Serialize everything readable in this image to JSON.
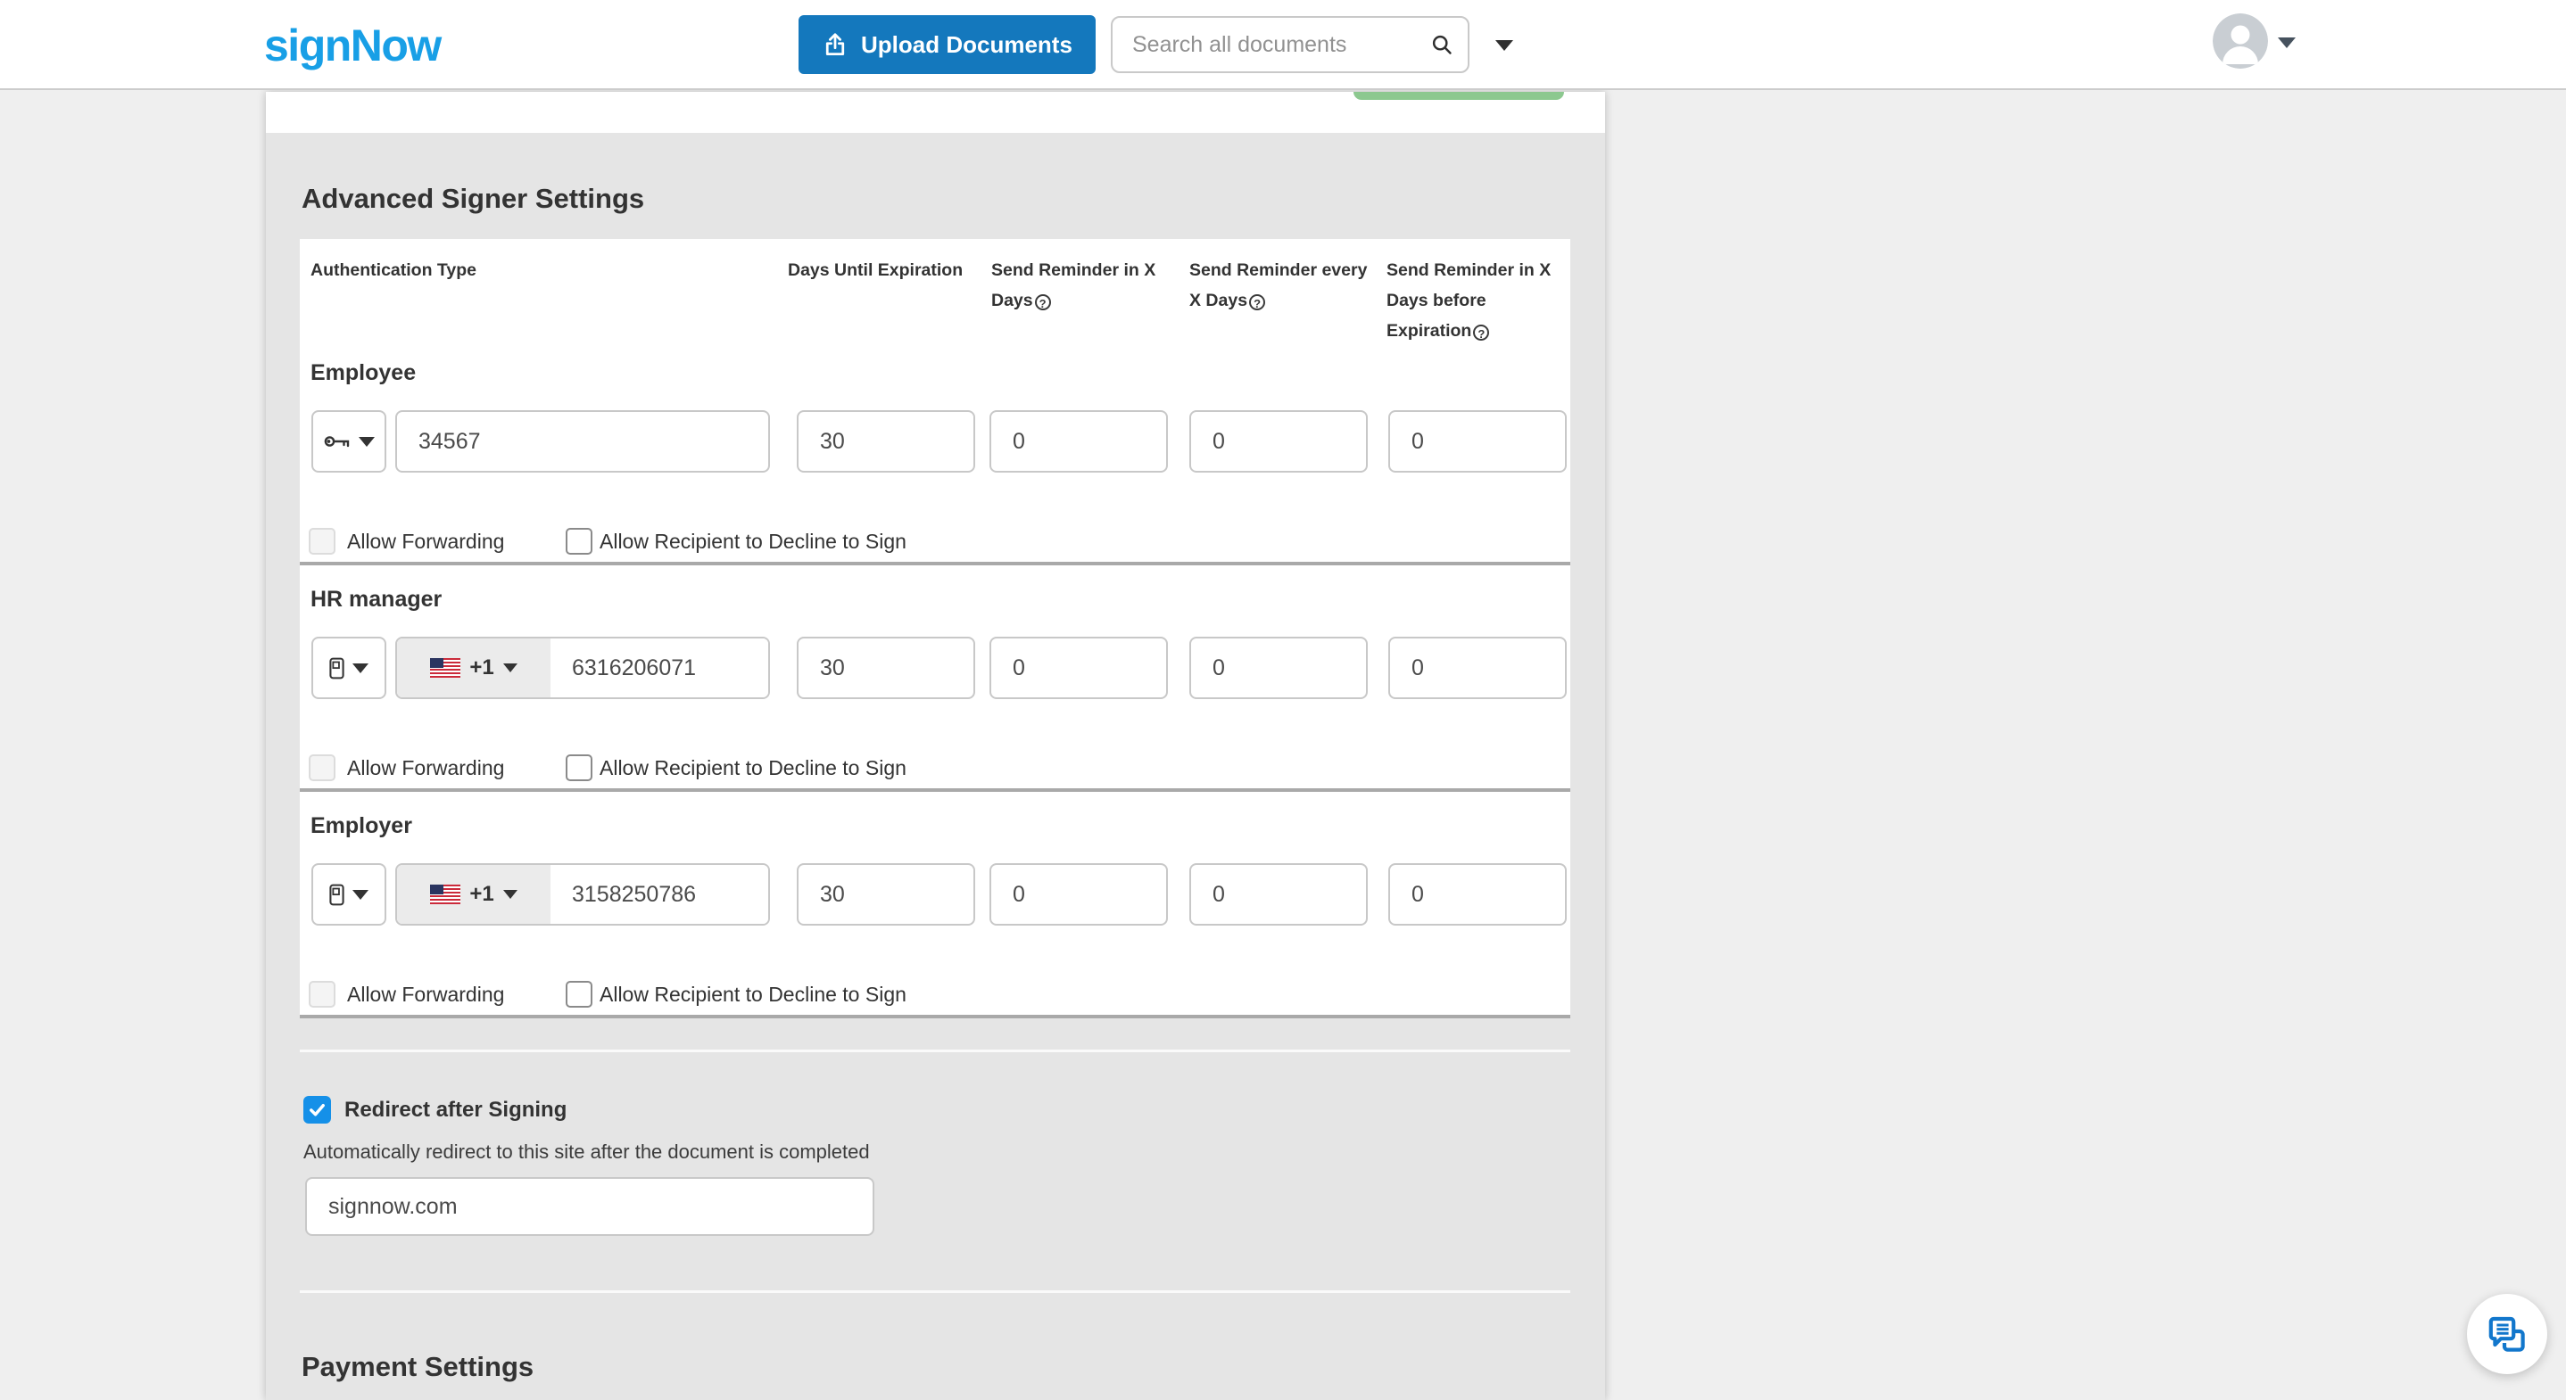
{
  "header": {
    "logo_text": "signNow",
    "upload_button_label": "Upload Documents",
    "search_placeholder": "Search all documents"
  },
  "advanced_signer_settings": {
    "title": "Advanced Signer Settings",
    "columns": [
      "Authentication Type",
      "Days Until Expiration",
      "Send Reminder in X Days",
      "Send Reminder every X Days",
      "Send Reminder in X Days before Expiration"
    ],
    "help_glyph": "?",
    "allow_forwarding_label": "Allow Forwarding",
    "allow_decline_label": "Allow Recipient to Decline to Sign",
    "signers": [
      {
        "name": "Employee",
        "auth_type": "password",
        "auth_value": "34567",
        "days_until_expiration": "30",
        "send_reminder_in_x_days": "0",
        "send_reminder_every_x_days": "0",
        "send_reminder_in_x_days_before_expiration": "0",
        "allow_forwarding": false,
        "allow_decline": false
      },
      {
        "name": "HR manager",
        "auth_type": "phone",
        "country_code": "+1",
        "auth_value": "6316206071",
        "days_until_expiration": "30",
        "send_reminder_in_x_days": "0",
        "send_reminder_every_x_days": "0",
        "send_reminder_in_x_days_before_expiration": "0",
        "allow_forwarding": false,
        "allow_decline": false
      },
      {
        "name": "Employer",
        "auth_type": "phone",
        "country_code": "+1",
        "auth_value": "3158250786",
        "days_until_expiration": "30",
        "send_reminder_in_x_days": "0",
        "send_reminder_every_x_days": "0",
        "send_reminder_in_x_days_before_expiration": "0",
        "allow_forwarding": false,
        "allow_decline": false
      }
    ]
  },
  "redirect_after_signing": {
    "label": "Redirect after Signing",
    "checked": true,
    "description": "Automatically redirect to this site after the document is completed",
    "url_value": "signnow.com"
  },
  "payment_settings": {
    "title": "Payment Settings"
  },
  "colors": {
    "brand_blue": "#189fe6",
    "upload_button_blue": "#1478bd",
    "checked_checkbox_blue": "#1590e8",
    "chat_icon_blue": "#1277cc",
    "green_button_fragment": "#8cc88f",
    "content_background": "#e5e5e5",
    "page_background": "#efefef",
    "divider_gray": "#a9a9a9"
  }
}
